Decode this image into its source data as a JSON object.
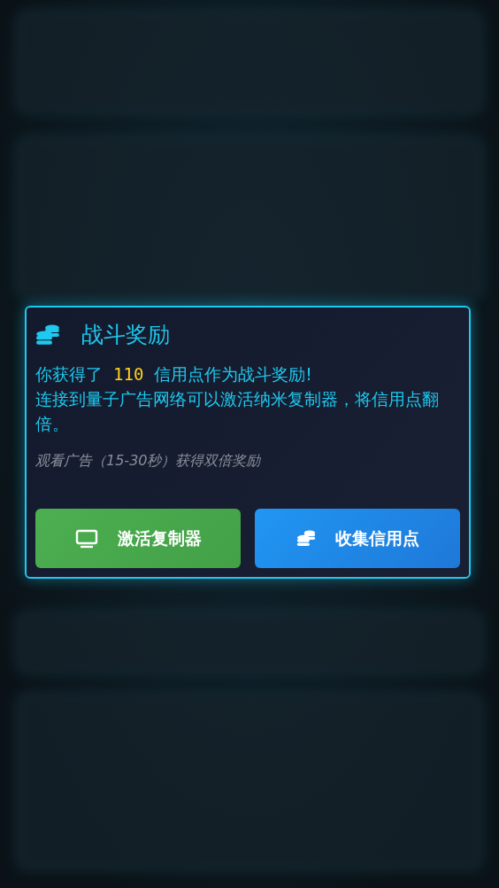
{
  "dialog": {
    "title": "战斗奖励",
    "reward_line": {
      "before": "你获得了",
      "amount": "110",
      "after": "信用点作为战斗奖励!"
    },
    "message": "连接到量子广告网络可以激活纳米复制器，将信用点翻倍。",
    "hint": "观看广告（15-30秒）获得双倍奖励",
    "buttons": [
      {
        "kind": "ad",
        "label": "激活复制器"
      },
      {
        "kind": "collect",
        "label": "收集信用点"
      }
    ]
  }
}
